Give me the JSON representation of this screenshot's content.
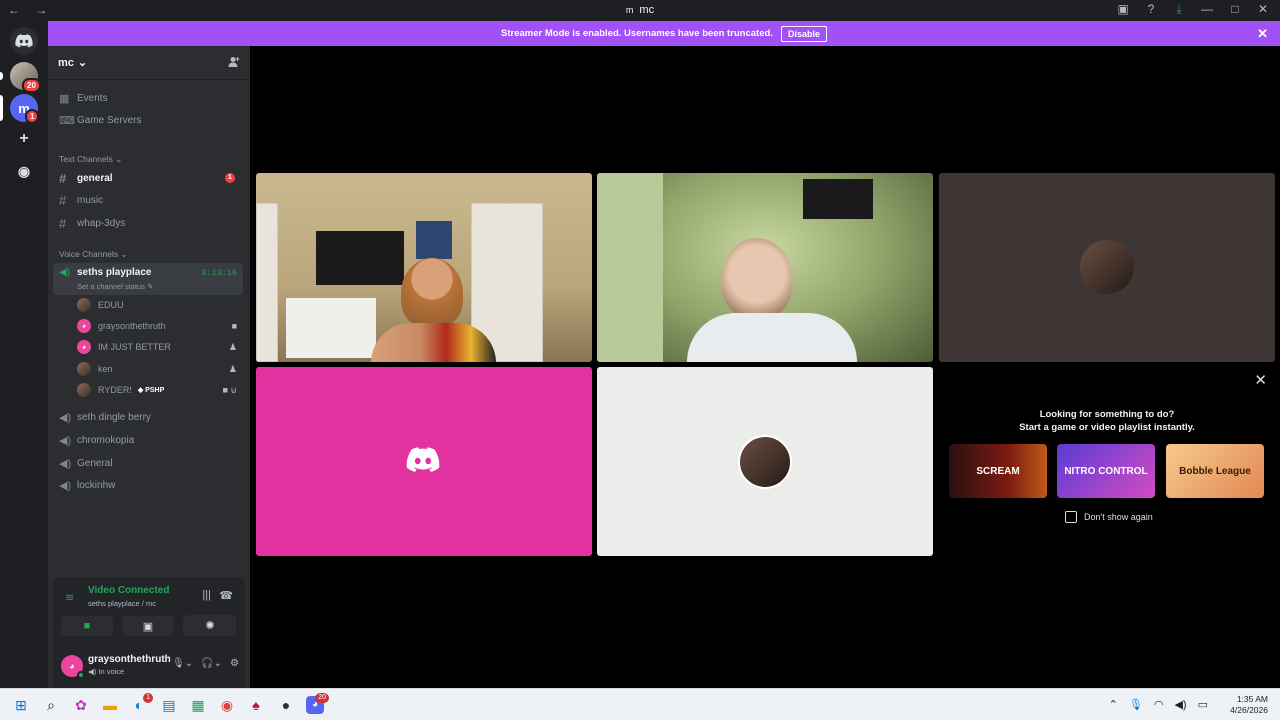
{
  "titlebar": {
    "nav_glyphs": "← →",
    "server_icon_letter": "m",
    "title": "mc",
    "controls": [
      "▣",
      "?",
      "⤓",
      "—",
      "□",
      "✕"
    ]
  },
  "banner": {
    "text": "Streamer Mode is enabled. Usernames have been truncated.",
    "button": "Disable",
    "close": "✕"
  },
  "guilds": [
    {
      "id": "home",
      "glyph": "☺"
    },
    {
      "id": "server1",
      "badge": "20"
    },
    {
      "id": "mc",
      "letter": "m",
      "badge": "1"
    },
    {
      "id": "add",
      "glyph": "+"
    },
    {
      "id": "discover",
      "glyph": "◉"
    }
  ],
  "server": {
    "name": "mc",
    "chevron": "⌄",
    "add_people": "👤",
    "events": "Events",
    "game_servers": "Game Servers"
  },
  "text_channels": {
    "label": "Text Channels",
    "items": [
      {
        "name": "general",
        "badge": "1"
      },
      {
        "name": "music"
      },
      {
        "name": "whap-3dys"
      }
    ]
  },
  "voice_channels": {
    "label": "Voice Channels",
    "active": {
      "name": "seths playplace",
      "time": "3:13:16",
      "status": "Set a channel status"
    },
    "members": [
      {
        "name": "EDUU"
      },
      {
        "name": "graysonthethruth",
        "icon": "■"
      },
      {
        "name": "IM JUST BETTER",
        "icon": "♟"
      },
      {
        "name": "ken",
        "icon": "♟"
      },
      {
        "name": "RYDER!",
        "tag": "PSHP",
        "icon": "■ ⊍"
      }
    ],
    "others": [
      "seth dingle berry",
      "chromokopia",
      "General",
      "lockinhw"
    ]
  },
  "voice_panel": {
    "status": "Video Connected",
    "sub": "seths playplace / mc"
  },
  "user": {
    "name": "graysonthethruth",
    "status": "In voice"
  },
  "promo": {
    "line1": "Looking for something to do?",
    "line2": "Start a game or video playlist instantly.",
    "games": [
      "SCREAM",
      "NITRO CONTROL",
      "Bobble League"
    ],
    "checkbox": "Don't show again"
  },
  "clock": {
    "time": "1:35 AM",
    "date": "4/26/2026"
  },
  "taskbar_badges": {
    "edge": "1",
    "discord": "20"
  }
}
